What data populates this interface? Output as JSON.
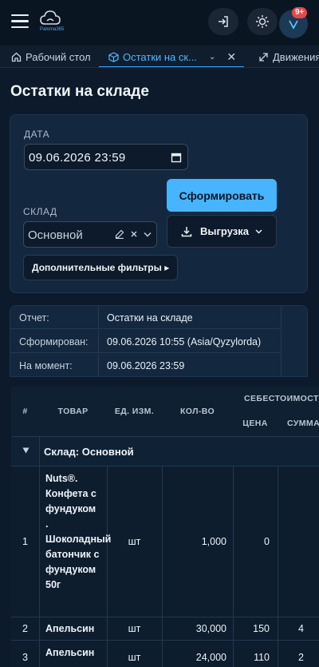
{
  "header": {
    "logo_text": "Paloma365",
    "notification_count": "9+"
  },
  "tabs": [
    {
      "label": "Рабочий стол"
    },
    {
      "label": "Остатки на ск..."
    },
    {
      "label": "Движения"
    }
  ],
  "page": {
    "title": "Остатки на складе"
  },
  "filters": {
    "date_label": "ДАТА",
    "date_value": "09.06.2026 23:59",
    "warehouse_label": "СКЛАД",
    "warehouse_value": "Основной",
    "generate_button": "Сформировать",
    "export_button": "Выгрузка",
    "extra_filters_button": "Дополнительные фильтры ▸"
  },
  "report_info": [
    {
      "key": "Отчет:",
      "value": "Остатки на складе"
    },
    {
      "key": "Сформирован:",
      "value": "09.06.2026 10:55 (Asia/Qyzylorda)"
    },
    {
      "key": "На момент:",
      "value": "09.06.2026 23:59"
    }
  ],
  "table": {
    "headers": {
      "num": "#",
      "product": "ТОВАР",
      "unit": "ЕД. ИЗМ.",
      "qty": "КОЛ-ВО",
      "cost_group": "СЕБЕСТОИМОСТЬ",
      "price": "ЦЕНА",
      "sum": "СУММА"
    },
    "group_label": "Склад: Основной",
    "rows": [
      {
        "num": "1",
        "product": "Nuts®. Конфета с фундуком . Шоколадный батончик с фундуком 50г",
        "unit": "шт",
        "qty": "1,000",
        "price": "0",
        "sum": ""
      },
      {
        "num": "2",
        "product": "Апельсин",
        "unit": "шт",
        "qty": "30,000",
        "price": "150",
        "sum": "4"
      },
      {
        "num": "3",
        "product": "Апельсин",
        "unit": "шт",
        "qty": "24,000",
        "price": "110",
        "sum": "2"
      }
    ]
  }
}
